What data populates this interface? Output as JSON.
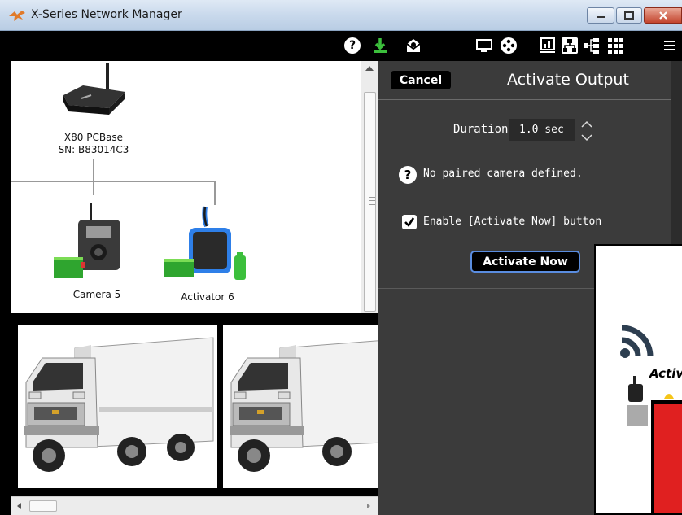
{
  "window": {
    "title": "X-Series Network Manager",
    "colors": {
      "toolbar_bg": "#000000",
      "panel_bg": "#3b3b3b",
      "accent_green": "#2fa52f",
      "button_border": "#5a8de0"
    }
  },
  "toolbar": {
    "icons": [
      "help-icon",
      "download-icon",
      "mail-icon",
      "monitor-icon",
      "film-reel-icon",
      "report-icon",
      "network-tree-icon",
      "hierarchy-icon",
      "grid-icon",
      "menu-icon"
    ],
    "help_glyph": "?"
  },
  "tree": {
    "base": {
      "name": "X80 PCBase",
      "serial": "SN: B83014C3"
    },
    "devices": [
      {
        "label": "Camera 5"
      },
      {
        "label": "Activator 6"
      }
    ]
  },
  "panel": {
    "cancel_label": "Cancel",
    "title": "Activate Output",
    "duration_label": "Duration:",
    "duration_value": "1.0 sec",
    "help_glyph": "?",
    "info_text": "No paired camera defined.",
    "checkbox_label": "Enable [Activate Now] button",
    "checkbox_checked": true,
    "activate_label": "Activate Now"
  },
  "popup": {
    "label": "Activ"
  }
}
